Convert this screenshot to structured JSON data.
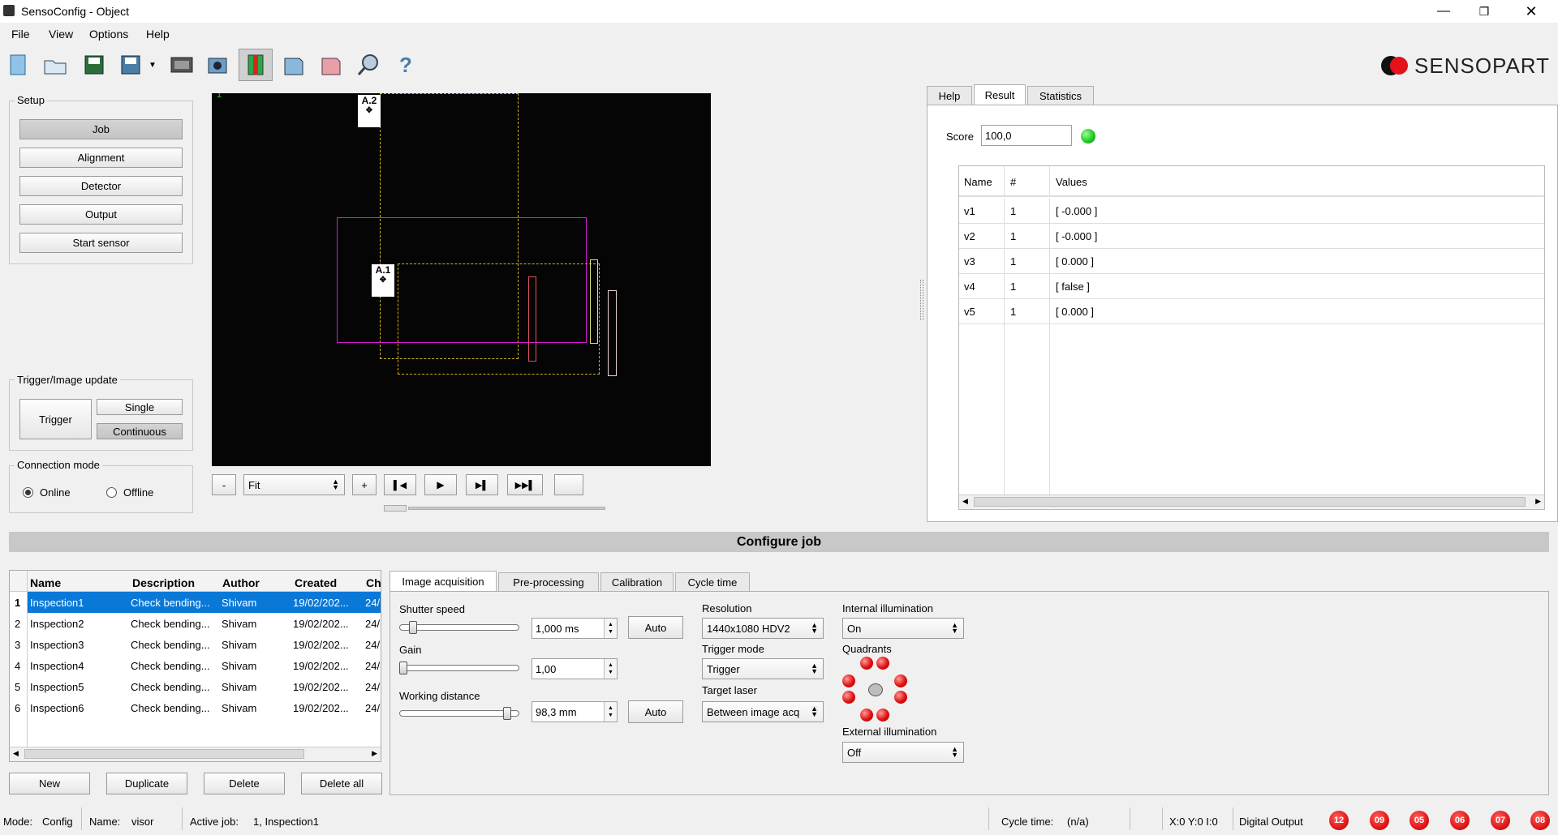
{
  "window": {
    "title": "SensoConfig - Object"
  },
  "menu": [
    "File",
    "View",
    "Options",
    "Help"
  ],
  "brand": {
    "name": "SENSOPART"
  },
  "toolbar": {
    "icons": [
      "new-job-icon",
      "open-icon",
      "save-icon",
      "save-as-icon",
      "dropdown-arrow-icon",
      "film-strip-icon",
      "camera-icon",
      "image-icon",
      "view-3d-icon",
      "page-icon",
      "inspect-icon",
      "help-icon"
    ]
  },
  "setup": {
    "title": "Setup",
    "buttons": [
      "Job",
      "Alignment",
      "Detector",
      "Output",
      "Start sensor"
    ]
  },
  "trigger": {
    "title": "Trigger/Image update",
    "trigger_label": "Trigger",
    "single_label": "Single",
    "continuous_label": "Continuous"
  },
  "connection": {
    "title": "Connection mode",
    "online": "Online",
    "offline": "Offline",
    "selected": "Online"
  },
  "image_view": {
    "marker": "1",
    "roi_labels": [
      "A.2",
      "A.1"
    ],
    "zoom_minus": "-",
    "zoom_value": "Fit",
    "zoom_plus": "+"
  },
  "right_panel": {
    "tabs": [
      "Help",
      "Result",
      "Statistics"
    ],
    "selected_tab": "Result",
    "score_label": "Score",
    "score_value": "100,0",
    "score_status_color": "#22cc22",
    "table": {
      "headers": [
        "Name",
        "#",
        "Values"
      ],
      "rows": [
        {
          "name": "v1",
          "num": "1",
          "value": "[ -0.000 ]"
        },
        {
          "name": "v2",
          "num": "1",
          "value": "[ -0.000 ]"
        },
        {
          "name": "v3",
          "num": "1",
          "value": "[ 0.000 ]"
        },
        {
          "name": "v4",
          "num": "1",
          "value": "[ false ]"
        },
        {
          "name": "v5",
          "num": "1",
          "value": "[ 0.000 ]"
        }
      ]
    }
  },
  "configure_job": {
    "title": "Configure job",
    "job_table": {
      "headers": [
        "Name",
        "Description",
        "Author",
        "Created",
        "Ch"
      ],
      "rows": [
        {
          "idx": "1",
          "name": "Inspection1",
          "desc": "Check bending...",
          "author": "Shivam",
          "created": "19/02/202...",
          "ch": "24/"
        },
        {
          "idx": "2",
          "name": "Inspection2",
          "desc": "Check bending...",
          "author": "Shivam",
          "created": "19/02/202...",
          "ch": "24/"
        },
        {
          "idx": "3",
          "name": "Inspection3",
          "desc": "Check bending...",
          "author": "Shivam",
          "created": "19/02/202...",
          "ch": "24/"
        },
        {
          "idx": "4",
          "name": "Inspection4",
          "desc": "Check bending...",
          "author": "Shivam",
          "created": "19/02/202...",
          "ch": "24/"
        },
        {
          "idx": "5",
          "name": "Inspection5",
          "desc": "Check bending...",
          "author": "Shivam",
          "created": "19/02/202...",
          "ch": "24/"
        },
        {
          "idx": "6",
          "name": "Inspection6",
          "desc": "Check bending...",
          "author": "Shivam",
          "created": "19/02/202...",
          "ch": "24/"
        }
      ]
    },
    "job_buttons": [
      "New",
      "Duplicate",
      "Delete",
      "Delete all"
    ],
    "tabs": [
      "Image acquisition",
      "Pre-processing",
      "Calibration",
      "Cycle time"
    ],
    "selected_tab": "Image acquisition",
    "acq": {
      "shutter_label": "Shutter speed",
      "shutter_value": "1,000 ms",
      "shutter_slider_fraction": 0.1,
      "gain_label": "Gain",
      "gain_value": "1,00",
      "gain_slider_fraction": 0.0,
      "wd_label": "Working distance",
      "wd_value": "98,3 mm",
      "wd_slider_fraction": 0.95,
      "auto_label": "Auto",
      "resolution_label": "Resolution",
      "resolution_value": "1440x1080 HDV2",
      "trigger_mode_label": "Trigger mode",
      "trigger_mode_value": "Trigger",
      "target_laser_label": "Target laser",
      "target_laser_value": "Between image acq",
      "internal_illum_label": "Internal illumination",
      "internal_illum_value": "On",
      "quadrants_label": "Quadrants",
      "external_illum_label": "External illumination",
      "external_illum_value": "Off"
    }
  },
  "status_bar": {
    "mode_label": "Mode:",
    "mode_value": "Config",
    "name_label": "Name:",
    "name_value": "visor",
    "active_job_label": "Active job:",
    "active_job_value": "1, Inspection1",
    "cycle_label": "Cycle time:",
    "cycle_value": "(n/a)",
    "coords": "X:0 Y:0 I:0",
    "digital_output_label": "Digital Output",
    "outputs": [
      "12",
      "09",
      "05",
      "06",
      "07",
      "08"
    ]
  }
}
